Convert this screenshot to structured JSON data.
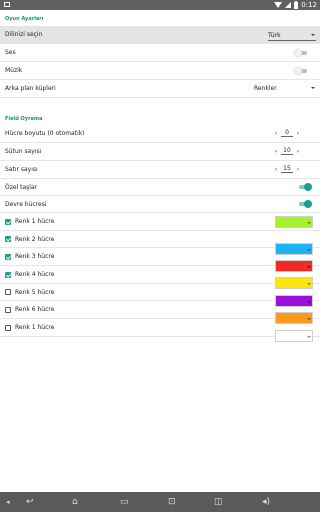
{
  "status_bar": {
    "time": "0:12"
  },
  "sections": {
    "game_settings": "Oyun Ayarları",
    "field": "Field Oyrama"
  },
  "game_settings": {
    "language": {
      "label": "Dilinizi seçin",
      "value": "Türk"
    },
    "sound": {
      "label": "Ses",
      "on": false
    },
    "music": {
      "label": "Müzik",
      "on": false
    },
    "background": {
      "label": "Arka plan küpleri",
      "value": "Renkler"
    }
  },
  "field": {
    "cell_size": {
      "label": "Hücre boyutu (0 otomatik)",
      "value": "0"
    },
    "columns": {
      "label": "Sütun sayısı",
      "value": "10"
    },
    "rows": {
      "label": "Satır sayısı",
      "value": "15"
    },
    "special_stones": {
      "label": "Özel taşlar",
      "on": true
    },
    "cycle_cell": {
      "label": "Devre hücresi",
      "on": true
    }
  },
  "colors": [
    {
      "label": "Renk 1 hücre",
      "checked": true,
      "color": "#a4f22a"
    },
    {
      "label": "Renk 2 hücre",
      "checked": true,
      "color": "#1fb3f2"
    },
    {
      "label": "Renk 3 hücre",
      "checked": true,
      "color": "#f12a23"
    },
    {
      "label": "Renk 4 hücre",
      "checked": true,
      "color": "#fbe50d"
    },
    {
      "label": "Renk 5 hücre",
      "checked": false,
      "color": "#9a10d8"
    },
    {
      "label": "Renk 6 hücre",
      "checked": false,
      "color": "#fc9a1e"
    },
    {
      "label": "Renk 1 hücre",
      "checked": false,
      "color": "#ffffff"
    }
  ],
  "nav_icons": [
    "back-arrow-icon",
    "home-icon",
    "recent-apps-icon",
    "screenshot-icon",
    "volume-down-icon",
    "volume-up-icon"
  ]
}
